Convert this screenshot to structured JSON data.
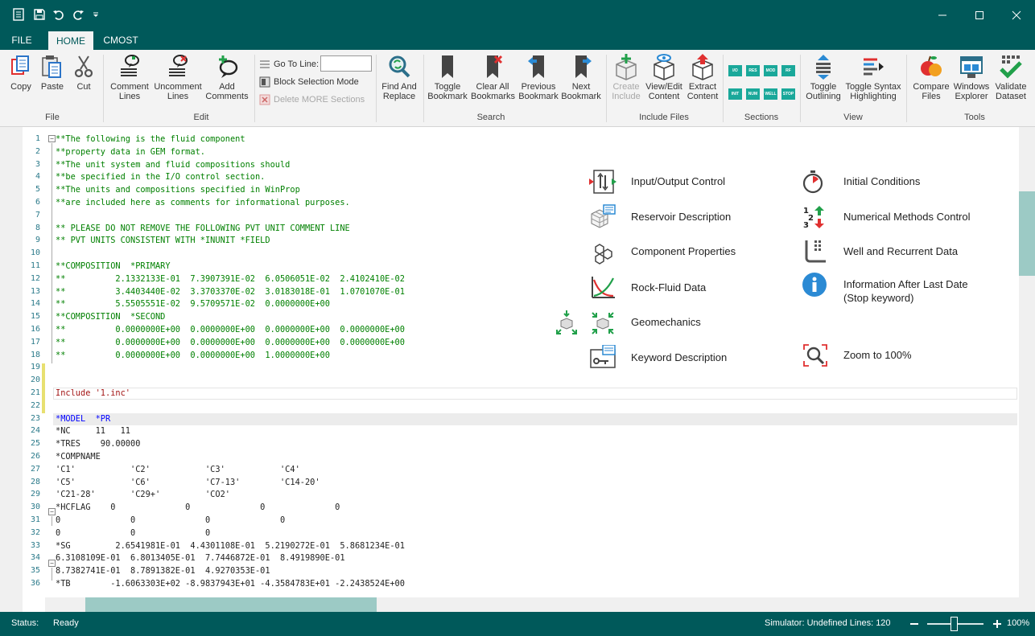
{
  "tabs": [
    {
      "label": "FILE"
    },
    {
      "label": "HOME"
    },
    {
      "label": "CMOST"
    }
  ],
  "ribbon": {
    "file": {
      "group_label": "File",
      "copy": "Copy",
      "paste": "Paste",
      "cut": "Cut"
    },
    "edit": {
      "group_label": "Edit",
      "comment_l1": "Comment",
      "comment_l2": "Lines",
      "uncomment_l1": "Uncomment",
      "uncomment_l2": "Lines",
      "add_l1": "Add",
      "add_l2": "Comments",
      "goto_label": "Go To Line:",
      "goto_value": "",
      "block_mode": "Block Selection Mode",
      "delete_more": "Delete MORE Sections"
    },
    "search": {
      "group_label": "Search",
      "find_l1": "Find And",
      "find_l2": "Replace",
      "toggle_l1": "Toggle",
      "toggle_l2": "Bookmark",
      "clear_l1": "Clear All",
      "clear_l2": "Bookmarks",
      "prev_l1": "Previous",
      "prev_l2": "Bookmark",
      "next_l1": "Next",
      "next_l2": "Bookmark"
    },
    "include": {
      "group_label": "Include Files",
      "create_l1": "Create",
      "create_l2": "Include",
      "view_l1": "View/Edit",
      "view_l2": "Content",
      "extract_l1": "Extract",
      "extract_l2": "Content"
    },
    "sections": {
      "group_label": "Sections",
      "icons": [
        "I/O",
        "RES",
        "MOD",
        "RF",
        "INIT",
        "NUM",
        "WELL",
        "STOP"
      ]
    },
    "view": {
      "group_label": "View",
      "outline_l1": "Toggle",
      "outline_l2": "Outlining",
      "syntax_l1": "Toggle Syntax",
      "syntax_l2": "Highlighting"
    },
    "tools": {
      "group_label": "Tools",
      "compare_l1": "Compare",
      "compare_l2": "Files",
      "explorer_l1": "Windows",
      "explorer_l2": "Explorer",
      "validate_l1": "Validate",
      "validate_l2": "Dataset"
    }
  },
  "code_lines": [
    {
      "n": "1",
      "t": "**The following is the fluid component",
      "c": "cmt"
    },
    {
      "n": "2",
      "t": "**property data in GEM format.",
      "c": "cmt"
    },
    {
      "n": "3",
      "t": "**The unit system and fluid compositions should",
      "c": "cmt"
    },
    {
      "n": "4",
      "t": "**be specified in the I/O control section.",
      "c": "cmt"
    },
    {
      "n": "5",
      "t": "**The units and compositions specified in WinProp",
      "c": "cmt"
    },
    {
      "n": "6",
      "t": "**are included here as comments for informational purposes.",
      "c": "cmt"
    },
    {
      "n": "7",
      "t": "",
      "c": "cmt"
    },
    {
      "n": "8",
      "t": "** PLEASE DO NOT REMOVE THE FOLLOWING PVT UNIT COMMENT LINE",
      "c": "cmt"
    },
    {
      "n": "9",
      "t": "** PVT UNITS CONSISTENT WITH *INUNIT *FIELD",
      "c": "cmt"
    },
    {
      "n": "10",
      "t": "",
      "c": "cmt"
    },
    {
      "n": "11",
      "t": "**COMPOSITION  *PRIMARY",
      "c": "cmt"
    },
    {
      "n": "12",
      "t": "**          2.1332133E-01  7.3907391E-02  6.0506051E-02  2.4102410E-02",
      "c": "cmt"
    },
    {
      "n": "13",
      "t": "**          3.4403440E-02  3.3703370E-02  3.0183018E-01  1.0701070E-01",
      "c": "cmt"
    },
    {
      "n": "14",
      "t": "**          5.5505551E-02  9.5709571E-02  0.0000000E+00",
      "c": "cmt"
    },
    {
      "n": "15",
      "t": "**COMPOSITION  *SECOND",
      "c": "cmt"
    },
    {
      "n": "16",
      "t": "**          0.0000000E+00  0.0000000E+00  0.0000000E+00  0.0000000E+00",
      "c": "cmt"
    },
    {
      "n": "17",
      "t": "**          0.0000000E+00  0.0000000E+00  0.0000000E+00  0.0000000E+00",
      "c": "cmt"
    },
    {
      "n": "18",
      "t": "**          0.0000000E+00  0.0000000E+00  1.0000000E+00",
      "c": "cmt"
    },
    {
      "n": "19",
      "t": "",
      "c": "plain"
    },
    {
      "n": "20",
      "t": "",
      "c": "plain"
    },
    {
      "n": "21",
      "t": "Include '1.inc'",
      "c": "str"
    },
    {
      "n": "22",
      "t": "",
      "c": "plain"
    },
    {
      "n": "23",
      "t": "*MODEL  *PR",
      "c": "kw"
    },
    {
      "n": "24",
      "t": "*NC     11   11",
      "c": "plain"
    },
    {
      "n": "25",
      "t": "*TRES    90.00000",
      "c": "plain"
    },
    {
      "n": "26",
      "t": "*COMPNAME",
      "c": "plain"
    },
    {
      "n": "27",
      "t": "'C1'           'C2'           'C3'           'C4'",
      "c": "plain"
    },
    {
      "n": "28",
      "t": "'C5'           'C6'           'C7-13'        'C14-20'",
      "c": "plain"
    },
    {
      "n": "29",
      "t": "'C21-28'       'C29+'         'CO2'",
      "c": "plain"
    },
    {
      "n": "30",
      "t": "*HCFLAG    0              0              0              0",
      "c": "plain"
    },
    {
      "n": "31",
      "t": "0              0              0              0",
      "c": "plain"
    },
    {
      "n": "32",
      "t": "0              0              0",
      "c": "plain"
    },
    {
      "n": "33",
      "t": "*SG         2.6541981E-01  4.4301108E-01  5.2190272E-01  5.8681234E-01",
      "c": "plain"
    },
    {
      "n": "34",
      "t": "6.3108109E-01  6.8013405E-01  7.7446872E-01  8.4919890E-01",
      "c": "plain"
    },
    {
      "n": "35",
      "t": "8.7382741E-01  8.7891382E-01  4.9270353E-01",
      "c": "plain"
    },
    {
      "n": "36",
      "t": "*TB        -1.6063303E+02 -8.9837943E+01 -4.3584783E+01 -2.2438524E+00",
      "c": "plain"
    }
  ],
  "quick_links": {
    "io": "Input/Output Control",
    "res": "Reservoir Description",
    "comp": "Component Properties",
    "rock": "Rock-Fluid Data",
    "geo": "Geomechanics",
    "kw": "Keyword Description",
    "init": "Initial Conditions",
    "num": "Numerical Methods Control",
    "well": "Well and Recurrent Data",
    "info_l1": "Information After Last Date",
    "info_l2": "(Stop keyword)",
    "zoom": "Zoom to 100%"
  },
  "status": {
    "label": "Status:",
    "value": "Ready",
    "right": "Simulator: Undefined Lines: 120",
    "zoom": "100%"
  },
  "colors": {
    "brand": "#00595a",
    "accent": "#1aa89a",
    "scroll_thumb": "#9ccac5"
  }
}
